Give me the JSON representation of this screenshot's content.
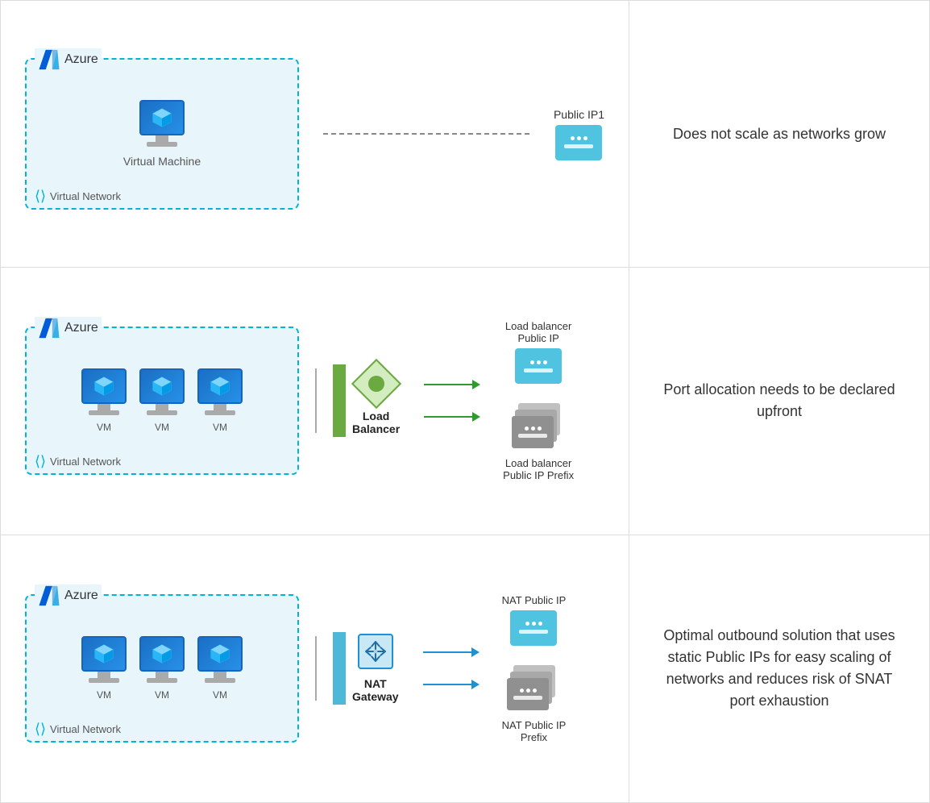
{
  "rows": [
    {
      "id": "row1",
      "azure_label": "Azure",
      "vm_label": "Virtual Machine",
      "vnet_label": "Virtual Network",
      "ip_label": "Public IP1",
      "description": "Does not scale as networks grow",
      "type": "single-vm"
    },
    {
      "id": "row2",
      "azure_label": "Azure",
      "vm_labels": [
        "VM",
        "VM",
        "VM"
      ],
      "vnet_label": "Virtual Network",
      "connector_label": "Load\nBalancer",
      "ip_top_label": "Load balancer\nPublic IP",
      "ip_bottom_label": "Load balancer\nPublic IP Prefix",
      "description": "Port allocation needs to be declared upfront",
      "type": "load-balancer"
    },
    {
      "id": "row3",
      "azure_label": "Azure",
      "vm_labels": [
        "VM",
        "VM",
        "VM"
      ],
      "vnet_label": "Virtual Network",
      "connector_label": "NAT\nGateway",
      "ip_top_label": "NAT Public IP",
      "ip_bottom_label": "NAT Public IP\nPrefix",
      "description": "Optimal outbound solution that uses static Public IPs for easy scaling of networks and reduces risk of SNAT port exhaustion",
      "type": "nat-gateway"
    }
  ]
}
